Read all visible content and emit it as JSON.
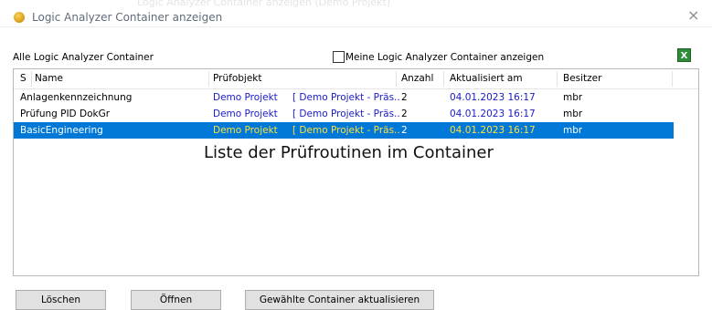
{
  "window": {
    "title": "Logic Analyzer Container anzeigen",
    "background_ghost_text": "Logic Analyzer Container anzeigen (Demo Projekt)",
    "close_glyph": "×"
  },
  "panel": {
    "group_label": "Alle Logic Analyzer Container",
    "filter_checkbox_label": "Meine Logic Analyzer Container anzeigen",
    "filter_checked": false,
    "export_glyph": "X",
    "export_icon": "excel-export-icon"
  },
  "table": {
    "columns": [
      "S",
      "Name",
      "Prüfobjekt",
      "Anzahl",
      "Aktualisiert am",
      "Besitzer"
    ],
    "rows": [
      {
        "name": "Anlagenkennzeichnung",
        "object": "Demo Projekt",
        "object_context": "[ Demo Projekt - Präs..",
        "count": "2",
        "updated": "04.01.2023 16:17",
        "owner": "mbr",
        "selected": false
      },
      {
        "name": "Prüfung PID DokGr",
        "object": "Demo Projekt",
        "object_context": "[ Demo Projekt - Präs..",
        "count": "2",
        "updated": "04.01.2023 16:17",
        "owner": "mbr",
        "selected": false
      },
      {
        "name": "BasicEngineering",
        "object": "Demo Projekt",
        "object_context": "[ Demo Projekt - Präs..",
        "count": "2",
        "updated": "04.01.2023 16:17",
        "owner": "mbr",
        "selected": true
      }
    ]
  },
  "caption": "Liste der Prüfroutinen im Container",
  "buttons": {
    "delete": "Löschen",
    "open": "Öffnen",
    "update": "Gewählte Container aktualisieren"
  },
  "colors": {
    "selection": "#0078d7",
    "link_text": "#1a1ac8",
    "selected_highlight_text": "#ffe13c",
    "export_green": "#2f8d3a"
  }
}
